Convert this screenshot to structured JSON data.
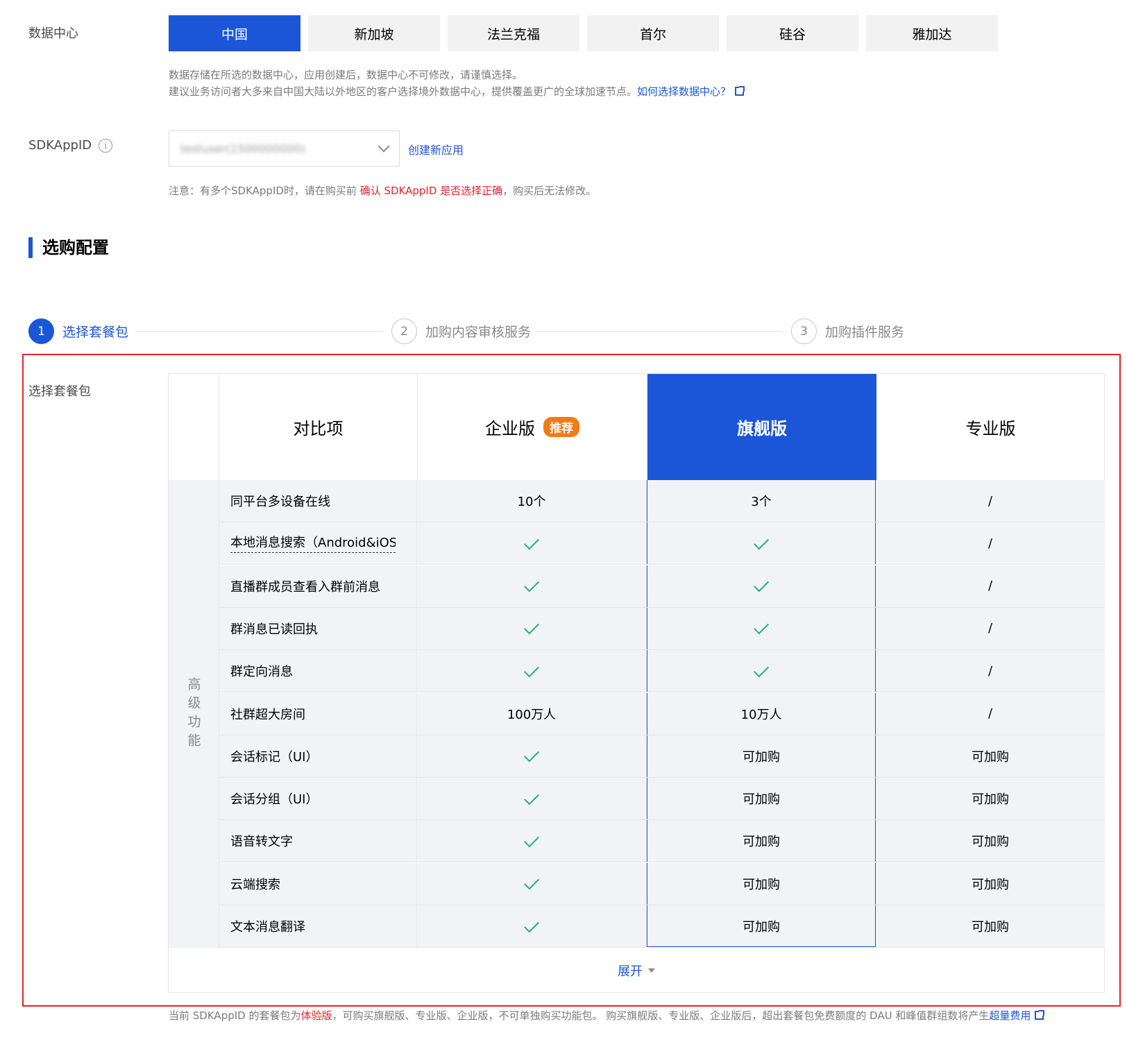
{
  "datacenter": {
    "label": "数据中心",
    "regions": [
      "中国",
      "新加坡",
      "法兰克福",
      "首尔",
      "硅谷",
      "雅加达"
    ],
    "active": "中国",
    "hint1": "数据存储在所选的数据中心，应用创建后，数据中心不可修改，请谨慎选择。",
    "hint2": "建议业务访问者大多来自中国大陆以外地区的客户选择境外数据中心，提供覆盖更广的全球加速节点。",
    "hint2_link": "如何选择数据中心？"
  },
  "sdk": {
    "label": "SDKAppID",
    "value": "testuser(1500000000)",
    "create_link": "创建新应用",
    "note_prefix": "注意：有多个SDKAppID时，请在购买前 ",
    "note_red": "确认 SDKAppID 是否选择正确",
    "note_suffix": "，购买后无法修改。"
  },
  "section_title": "选购配置",
  "steps": [
    {
      "num": "1",
      "label": "选择套餐包"
    },
    {
      "num": "2",
      "label": "加购内容审核服务"
    },
    {
      "num": "3",
      "label": "加购插件服务"
    }
  ],
  "package": {
    "label": "选择套餐包",
    "headers": {
      "compare": "对比项",
      "enterprise": "企业版",
      "enterprise_tag": "推荐",
      "flagship": "旗舰版",
      "pro": "专业版"
    },
    "group": "高级功能",
    "rows": [
      {
        "name": "同平台多设备在线",
        "v1": "10个",
        "v2": "3个",
        "v3": "/"
      },
      {
        "name": "本地消息搜索（Android&iOS）",
        "v1": "check",
        "v2": "check",
        "v3": "/"
      },
      {
        "name": "直播群成员查看入群前消息",
        "v1": "check",
        "v2": "check",
        "v3": "/"
      },
      {
        "name": "群消息已读回执",
        "v1": "check",
        "v2": "check",
        "v3": "/"
      },
      {
        "name": "群定向消息",
        "v1": "check",
        "v2": "check",
        "v3": "/"
      },
      {
        "name": "社群超大房间",
        "v1": "100万人",
        "v2": "10万人",
        "v3": "/"
      },
      {
        "name": "会话标记（UI）",
        "v1": "check",
        "v2": "可加购",
        "v3": "可加购"
      },
      {
        "name": "会话分组（UI）",
        "v1": "check",
        "v2": "可加购",
        "v3": "可加购"
      },
      {
        "name": "语音转文字",
        "v1": "check",
        "v2": "可加购",
        "v3": "可加购"
      },
      {
        "name": "云端搜索",
        "v1": "check",
        "v2": "可加购",
        "v3": "可加购"
      },
      {
        "name": "文本消息翻译",
        "v1": "check",
        "v2": "可加购",
        "v3": "可加购"
      }
    ],
    "expand_label": "展开"
  },
  "footer": {
    "prefix": "当前 SDKAppID 的套餐包为",
    "trial": "体验版",
    "middle": "，可购买旗舰版、专业版、企业版，不可单独购买功能包。 购买旗舰版、专业版、企业版后，超出套餐包免费额度的 DAU 和峰值群组数将产生",
    "link": "超量费用"
  },
  "colors": {
    "primary": "#1c56d8",
    "danger": "#e5212b",
    "tag": "#f07b17",
    "check": "#25b36a"
  }
}
